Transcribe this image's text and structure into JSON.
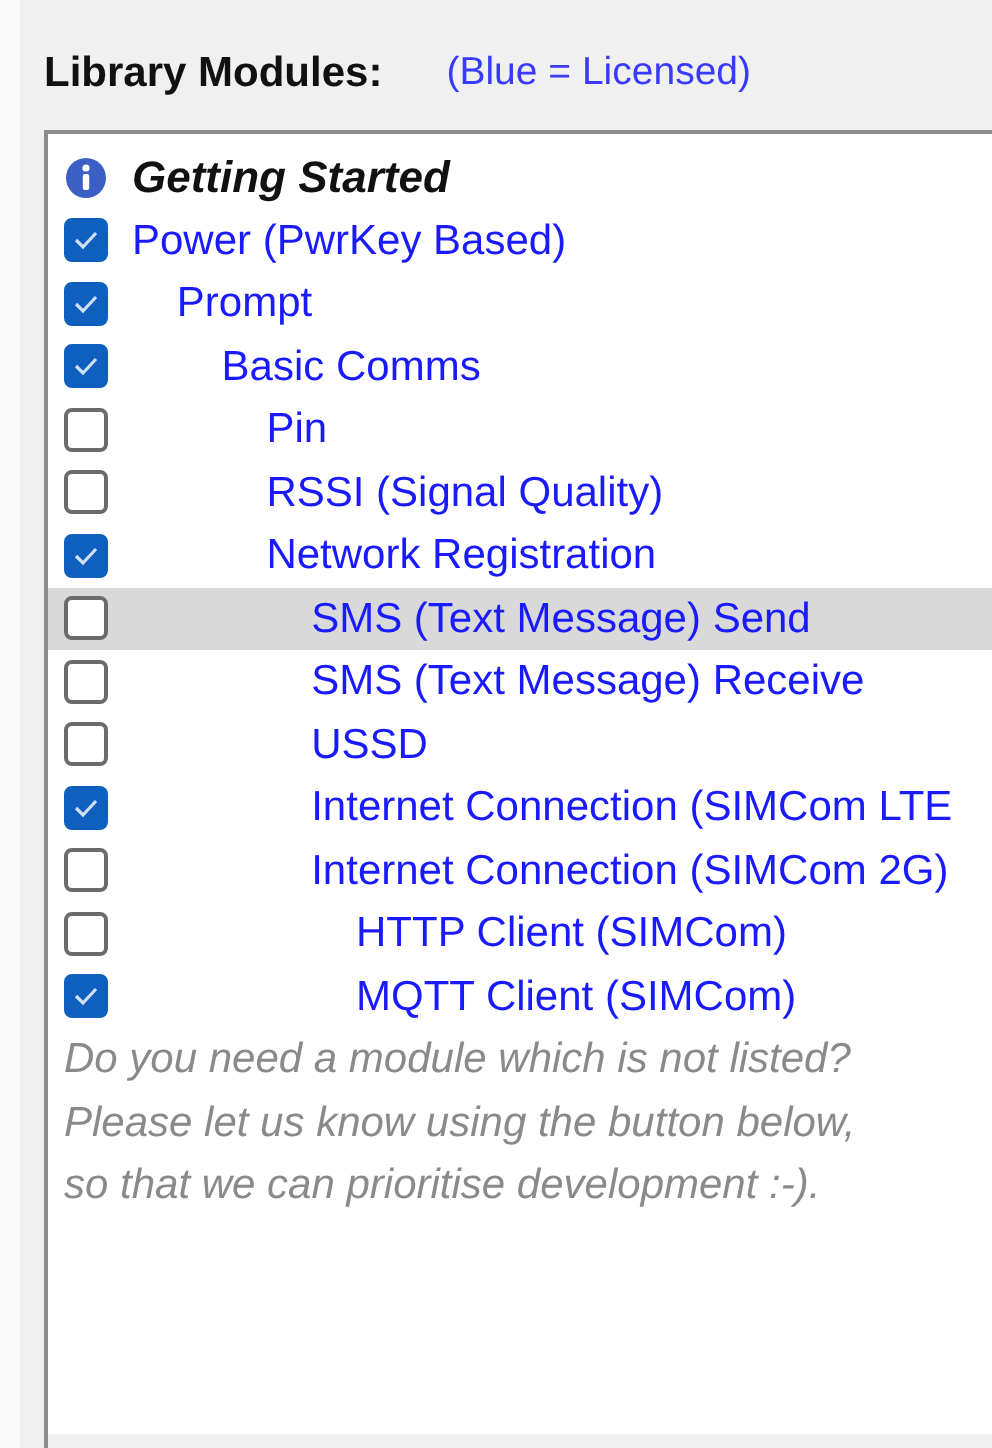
{
  "header": {
    "title": "Library Modules:",
    "legend": "(Blue = Licensed)"
  },
  "tree": [
    {
      "kind": "info",
      "label": "Getting Started"
    },
    {
      "kind": "module",
      "label": "Power (PwrKey Based)",
      "checked": true,
      "selected": false,
      "children": [
        {
          "kind": "module",
          "label": "Prompt",
          "checked": true,
          "selected": false,
          "children": [
            {
              "kind": "module",
              "label": "Basic Comms",
              "checked": true,
              "selected": false,
              "children": [
                {
                  "kind": "module",
                  "label": "Pin",
                  "checked": false,
                  "selected": false
                },
                {
                  "kind": "module",
                  "label": "RSSI (Signal Quality)",
                  "checked": false,
                  "selected": false
                },
                {
                  "kind": "module",
                  "label": "Network Registration",
                  "checked": true,
                  "selected": false,
                  "children": [
                    {
                      "kind": "module",
                      "label": "SMS (Text Message) Send",
                      "checked": false,
                      "selected": true
                    },
                    {
                      "kind": "module",
                      "label": "SMS (Text Message) Receive",
                      "checked": false,
                      "selected": false
                    },
                    {
                      "kind": "module",
                      "label": "USSD",
                      "checked": false,
                      "selected": false
                    },
                    {
                      "kind": "module",
                      "label": "Internet Connection (SIMCom LTE",
                      "checked": true,
                      "selected": false
                    },
                    {
                      "kind": "module",
                      "label": "Internet Connection (SIMCom 2G)",
                      "checked": false,
                      "selected": false,
                      "children": [
                        {
                          "kind": "module",
                          "label": "HTTP Client (SIMCom)",
                          "checked": false,
                          "selected": false
                        },
                        {
                          "kind": "module",
                          "label": "MQTT Client (SIMCom)",
                          "checked": true,
                          "selected": false
                        }
                      ]
                    }
                  ]
                }
              ]
            }
          ]
        }
      ]
    }
  ],
  "note": [
    "Do you need a module which is not listed?",
    "Please let us know using the button below,",
    "so that we can prioritise development :-)."
  ]
}
